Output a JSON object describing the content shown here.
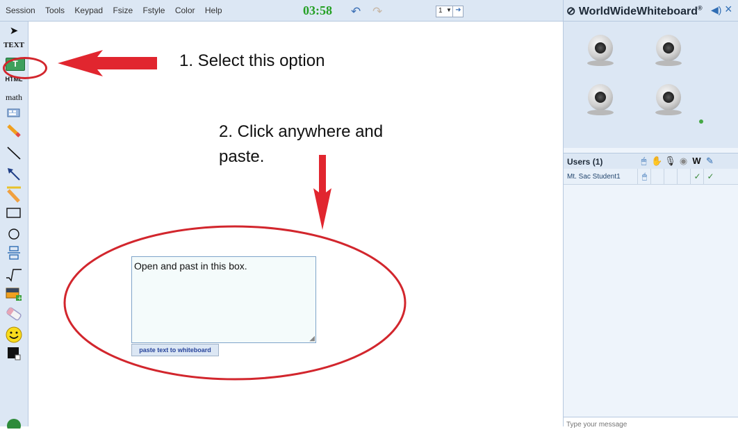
{
  "menu": [
    "Session",
    "Tools",
    "Keypad",
    "Fsize",
    "Fstyle",
    "Color",
    "Help"
  ],
  "timer": "03:58",
  "page_select": {
    "value": "1"
  },
  "brand": {
    "name": "WorldWideWhiteboard",
    "trademark": "®"
  },
  "tools": {
    "text": "TEXT",
    "paste_text": "T",
    "html": "HTML",
    "math": "math"
  },
  "annotations": {
    "step1": "1. Select this option",
    "step2": "2. Click anywhere and paste."
  },
  "editor": {
    "value": "Open and past in this box.",
    "paste_button": "paste text to whiteboard"
  },
  "users": {
    "title": "Users (1)",
    "w_col": "W",
    "rows": [
      {
        "name": "Mt. Sac Student1",
        "w": "✓",
        "last": "✓"
      }
    ]
  },
  "chat": {
    "placeholder": "Type your message"
  },
  "colors": {
    "annotation_red": "#d2262d",
    "timer_green": "#24a024",
    "toolbar_bg": "#dce7f4"
  },
  "icons": [
    "pointer-icon",
    "pencil-icon",
    "line-icon",
    "arrow-icon",
    "highlighter-icon",
    "rectangle-icon",
    "ellipse-icon",
    "insert-space-icon",
    "graph-icon",
    "image-icon",
    "eraser-icon",
    "smiley-icon",
    "color-swatch-icon",
    "webcam-icon",
    "speaker-icon",
    "close-icon"
  ]
}
